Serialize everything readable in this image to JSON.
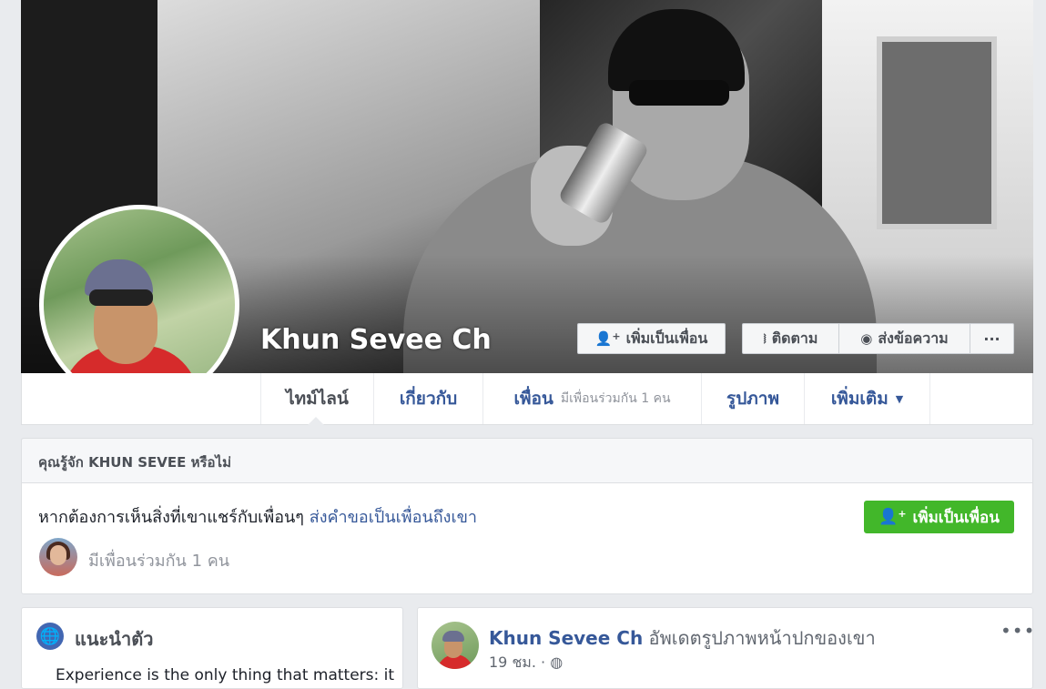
{
  "profile": {
    "name": "Khun Sevee Ch",
    "buttons": {
      "add_friend": "เพิ่มเป็นเพื่อน",
      "follow": "ติดตาม",
      "message": "ส่งข้อความ",
      "more": "···"
    }
  },
  "nav": {
    "timeline": "ไทม์ไลน์",
    "about": "เกี่ยวกับ",
    "friends": "เพื่อน",
    "friends_sub": "มีเพื่อนร่วมกัน 1 คน",
    "photos": "รูปภาพ",
    "more": "เพิ่มเติม",
    "more_caret": "▼"
  },
  "know_card": {
    "title": "คุณรู้จัก KHUN SEVEE หรือไม่",
    "desc_prefix": "หากต้องการเห็นสิ่งที่เขาแชร์กับเพื่อนๆ ",
    "desc_link": "ส่งคำขอเป็นเพื่อนถึงเขา",
    "add_button": "เพิ่มเป็นเพื่อน",
    "mutual": "มีเพื่อนร่วมกัน 1 คน"
  },
  "intro": {
    "title": "แนะนำตัว",
    "text": "Experience is the only thing that matters: it"
  },
  "post": {
    "author": "Khun Sevee Ch",
    "action": " อัพเดตรูปภาพหน้าปกของเขา",
    "time": "19 ชม. · ",
    "globe": "◍",
    "menu": "•••"
  },
  "icons": {
    "add_friend": "add-friend-icon",
    "follow": "rss-icon",
    "message": "messenger-icon",
    "globe": "globe-icon",
    "intro": "globe-icon"
  },
  "colors": {
    "link": "#365899",
    "green": "#42b72a",
    "background": "#e9ebee"
  }
}
